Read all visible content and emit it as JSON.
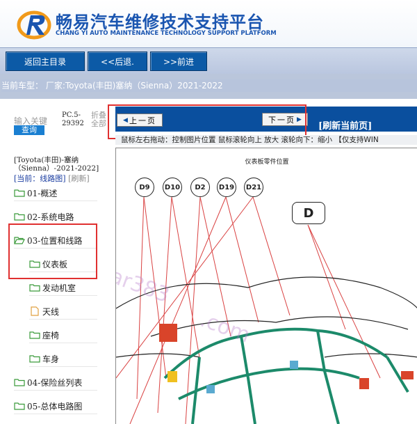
{
  "header": {
    "brand_cn": "畅易汽车维修技术支持平台",
    "brand_en": "CHANG YI AUTO MAINTENANCE TECHNOLOGY SUPPORT PLATFORM"
  },
  "nav": {
    "home": "返回主目录",
    "back": "<<后退.",
    "forward": ">>前进"
  },
  "current_vehicle": "当前车型： 厂家:Toyota(丰田)塞纳（Sienna）2021-2022",
  "sidebar": {
    "search_label": "输入关键",
    "search_button": "查询",
    "pc_line1": "PC.5-",
    "pc_line2": "29392",
    "fold_line1": "折叠",
    "fold_line2": "全部",
    "vehicle": "[Toyota(丰田)-塞纳（Sienna）-2021-2022]",
    "current_label": "[当前：线路图]",
    "refresh_label": "[刷新]",
    "items": [
      {
        "label": "01-概述"
      },
      {
        "label": "02-系统电路"
      },
      {
        "label": "03-位置和线路"
      },
      {
        "label": "仪表板"
      },
      {
        "label": "发动机室"
      },
      {
        "label": "天线"
      },
      {
        "label": "座椅"
      },
      {
        "label": "车身"
      },
      {
        "label": "04-保险丝列表"
      },
      {
        "label": "05-总体电路图"
      }
    ]
  },
  "pager": {
    "prev": "上一页",
    "next": "下一页",
    "refresh": "[刷新当前页]"
  },
  "hint": "鼠标左右拖动：控制图片位置  鼠标滚轮向上 放大  滚轮向下：缩小 【仅支持WIN",
  "diagram": {
    "title": "仪表板零件位置",
    "connectors": [
      "D9",
      "D10",
      "D2",
      "D19",
      "D21"
    ],
    "box_label": "D",
    "watermark1": "ar383",
    "watermark2": ".com"
  },
  "colors": {
    "nav_button": "#0c5aa6",
    "pager_bg": "#0a4f9e",
    "highlight": "#e03030",
    "brand": "#1a55b0"
  }
}
